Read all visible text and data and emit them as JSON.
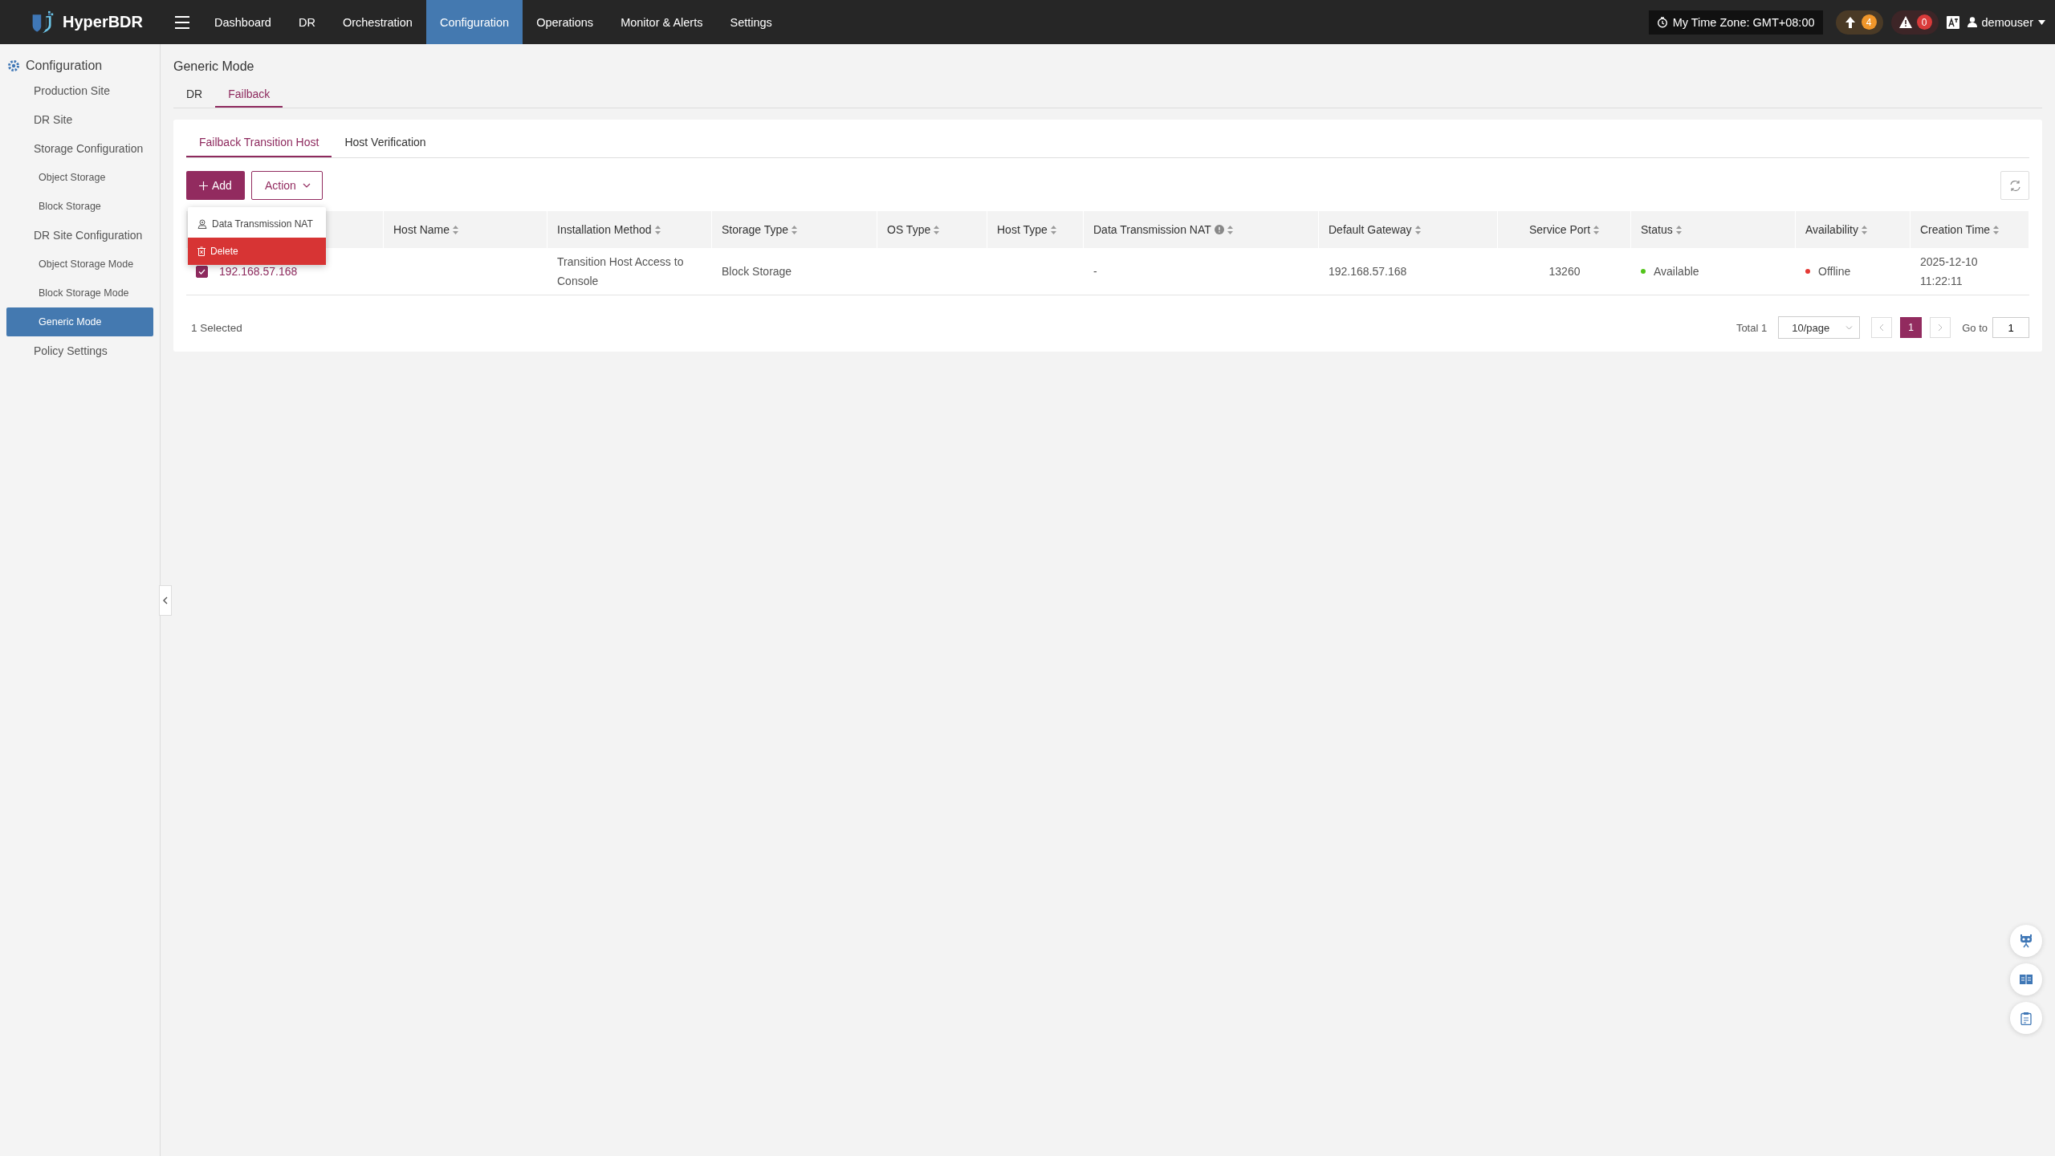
{
  "topbar": {
    "brand": "HyperBDR",
    "nav": [
      {
        "label": "Dashboard",
        "selected": false
      },
      {
        "label": "DR",
        "selected": false
      },
      {
        "label": "Orchestration",
        "selected": false
      },
      {
        "label": "Configuration",
        "selected": true
      },
      {
        "label": "Operations",
        "selected": false
      },
      {
        "label": "Monitor & Alerts",
        "selected": false
      },
      {
        "label": "Settings",
        "selected": false
      }
    ],
    "time_zone": "My Time Zone: GMT+08:00",
    "upload_count": "4",
    "alert_count": "0",
    "user": "demouser"
  },
  "sidebar": {
    "title": "Configuration",
    "items": [
      {
        "label": "Production Site",
        "selected": false
      },
      {
        "label": "DR Site",
        "selected": false
      },
      {
        "label": "Storage Configuration",
        "selected": false,
        "children": [
          {
            "label": "Object Storage",
            "selected": false
          },
          {
            "label": "Block Storage",
            "selected": false
          }
        ]
      },
      {
        "label": "DR Site Configuration",
        "selected": false,
        "children": [
          {
            "label": "Object Storage Mode",
            "selected": false
          },
          {
            "label": "Block Storage Mode",
            "selected": false
          },
          {
            "label": "Generic Mode",
            "selected": true
          }
        ]
      },
      {
        "label": "Policy Settings",
        "selected": false
      }
    ]
  },
  "page_title": "Generic Mode",
  "tabs": [
    {
      "label": "DR",
      "selected": false
    },
    {
      "label": "Failback",
      "selected": true
    }
  ],
  "subtabs": [
    {
      "label": "Failback Transition Host",
      "selected": true
    },
    {
      "label": "Host Verification",
      "selected": false
    }
  ],
  "toolbar": {
    "add": "Add",
    "action": "Action"
  },
  "action_menu": [
    {
      "label": "Data Transmission NAT",
      "kind": "nat"
    },
    {
      "label": "Delete",
      "kind": "danger"
    }
  ],
  "table": {
    "columns": [
      {
        "kind": "text"
      },
      {
        "label": "Host Name",
        "kind": "text"
      },
      {
        "label": "Installation Method",
        "kind": "text"
      },
      {
        "label": "Storage Type",
        "kind": "text"
      },
      {
        "label": "OS Type",
        "kind": "text"
      },
      {
        "label": "Host Type",
        "kind": "text"
      },
      {
        "label": "Data Transmission NAT",
        "kind": "info"
      },
      {
        "label": "Default Gateway",
        "kind": "text"
      },
      {
        "label": "Service Port",
        "kind": "number"
      },
      {
        "label": "Status",
        "kind": "text"
      },
      {
        "label": "Availability",
        "kind": "text"
      },
      {
        "label": "Creation Time",
        "kind": "text"
      }
    ],
    "rows": [
      {
        "selected": true,
        "cells": [
          {
            "kind": "link",
            "text": "192.168.57.168"
          },
          {
            "kind": "empty"
          },
          {
            "kind": "text",
            "text": "Transition Host Access to Console"
          },
          {
            "kind": "text",
            "text": "Block Storage"
          },
          {
            "kind": "empty"
          },
          {
            "kind": "empty"
          },
          {
            "kind": "text",
            "text": "-"
          },
          {
            "kind": "text",
            "text": "192.168.57.168"
          },
          {
            "kind": "text",
            "text": "13260"
          },
          {
            "kind": "status",
            "text": "Available",
            "color": "#52c41a"
          },
          {
            "kind": "status",
            "text": "Offline",
            "color": "#e53935"
          },
          {
            "kind": "text",
            "text": "2025-12-10 11:22:11"
          }
        ]
      }
    ]
  },
  "footer": {
    "selected_count": "1 Selected",
    "total": "Total 1",
    "page_size": "10/page",
    "pages": [
      {
        "label": "1",
        "selected": true
      }
    ],
    "goto_label": "Go to",
    "goto_value": "1"
  }
}
